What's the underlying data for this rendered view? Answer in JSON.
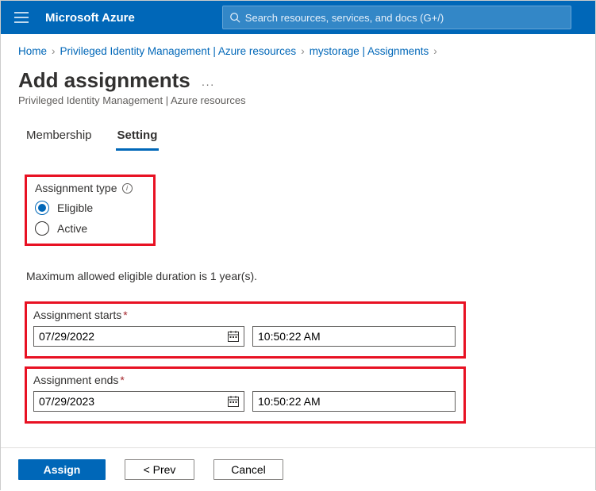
{
  "topbar": {
    "brand": "Microsoft Azure",
    "search_placeholder": "Search resources, services, and docs (G+/)"
  },
  "breadcrumb": {
    "items": [
      "Home",
      "Privileged Identity Management | Azure resources",
      "mystorage | Assignments"
    ]
  },
  "title": {
    "heading": "Add assignments",
    "subtitle": "Privileged Identity Management | Azure resources"
  },
  "tabs": {
    "membership": "Membership",
    "setting": "Setting",
    "active": "setting"
  },
  "assignment_type": {
    "label": "Assignment type",
    "options": {
      "eligible": "Eligible",
      "active": "Active"
    },
    "selected": "eligible"
  },
  "duration_note": "Maximum allowed eligible duration is 1 year(s).",
  "starts": {
    "label": "Assignment starts",
    "date": "07/29/2022",
    "time": "10:50:22 AM"
  },
  "ends": {
    "label": "Assignment ends",
    "date": "07/29/2023",
    "time": "10:50:22 AM"
  },
  "footer": {
    "assign": "Assign",
    "prev": "<  Prev",
    "cancel": "Cancel"
  }
}
